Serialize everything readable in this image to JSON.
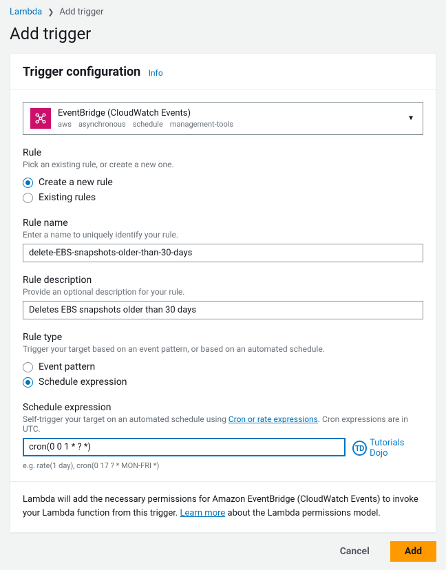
{
  "breadcrumb": {
    "parent": "Lambda",
    "current": "Add trigger"
  },
  "page_title": "Add trigger",
  "panel": {
    "heading": "Trigger configuration",
    "info_label": "Info"
  },
  "source": {
    "name": "EventBridge (CloudWatch Events)",
    "tags": [
      "aws",
      "asynchronous",
      "schedule",
      "management-tools"
    ]
  },
  "rule_section": {
    "label": "Rule",
    "help": "Pick an existing rule, or create a new one.",
    "options": {
      "create": "Create a new rule",
      "existing": "Existing rules"
    },
    "selected": "create"
  },
  "rule_name": {
    "label": "Rule name",
    "help": "Enter a name to uniquely identify your rule.",
    "value": "delete-EBS-snapshots-older-than-30-days"
  },
  "rule_desc": {
    "label": "Rule description",
    "help": "Provide an optional description for your rule.",
    "value": "Deletes EBS snapshots older than 30 days"
  },
  "rule_type": {
    "label": "Rule type",
    "help": "Trigger your target based on an event pattern, or based on an automated schedule.",
    "options": {
      "pattern": "Event pattern",
      "schedule": "Schedule expression"
    },
    "selected": "schedule"
  },
  "schedule": {
    "label": "Schedule expression",
    "help_prefix": "Self-trigger your target on an automated schedule using ",
    "help_link": "Cron or rate expressions",
    "help_suffix": ". Cron expressions are in UTC.",
    "value": "cron(0 0 1 * ? *)",
    "example": "e.g. rate(1 day), cron(0 17 ? * MON-FRI *)"
  },
  "watermark": {
    "badge": "TD",
    "text": "Tutorials Dojo"
  },
  "perm_note": {
    "text_prefix": "Lambda will add the necessary permissions for Amazon EventBridge (CloudWatch Events) to invoke your Lambda function from this trigger. ",
    "link": "Learn more",
    "text_suffix": " about the Lambda permissions model."
  },
  "footer": {
    "cancel": "Cancel",
    "add": "Add"
  }
}
